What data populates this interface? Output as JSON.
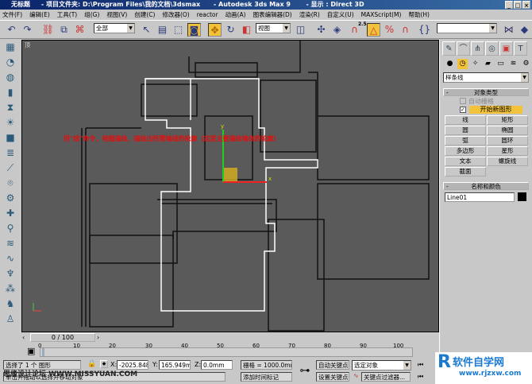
{
  "title": {
    "text": "无标题     - 项目文件夹: D:\\Program Files\\我的文档\\3dsmax      - Autodesk 3ds Max 9       - 显示 : Direct 3D",
    "min": "_",
    "max": "□",
    "close": "×"
  },
  "menu": [
    "文件(F)",
    "编辑(E)",
    "工具(T)",
    "组(G)",
    "视图(V)",
    "创建(C)",
    "修改器(O)",
    "reactor",
    "动画(A)",
    "图表编辑器(D)",
    "渲染(R)",
    "自定义(U)",
    "MAXScript(M)",
    "帮助(H)"
  ],
  "toolbar": {
    "selection_filter": "全部",
    "ref_coord": "视图",
    "named_sel": "",
    "snap_value": "2.5"
  },
  "viewport": {
    "label": "顶",
    "instruction": "用\"线\"命令，将图描绘，描绘出所需墙线的轮廓（这里主要描绘墙体的轮廓）"
  },
  "panel": {
    "category": "样条线",
    "object_type": {
      "title": "对象类型",
      "auto_grid": "自动栅格",
      "start_new_shape": "开始新图形",
      "buttons": [
        "线",
        "矩形",
        "圆",
        "椭圆",
        "弧",
        "圆环",
        "多边形",
        "星形",
        "文本",
        "螺旋线",
        "截面"
      ]
    },
    "name_color": {
      "title": "名称和颜色",
      "name": "Line01",
      "color": "#000000"
    }
  },
  "timeslider": {
    "value": "0 / 100",
    "ticks": [
      "0",
      "10",
      "20",
      "30",
      "40",
      "50",
      "60",
      "70",
      "80",
      "90",
      "100"
    ]
  },
  "status": {
    "selected": "选择了 1 个 图形",
    "prompt": "单击并拖动以选择并移动对象",
    "x": "-2025.848",
    "y": "165.949mm",
    "z": "0.0mm",
    "grid": "栅格 = 1000.0mm",
    "add_time_tag": "添加时间标记",
    "auto_key": "自动关键点",
    "set_key": "设置关键点",
    "key_mode": "选定对象",
    "key_filters": "关键点过滤器..."
  },
  "watermarks": {
    "left": "思缘设计论坛 WWW.MISSYUAN.COM",
    "right": "软件自学网",
    "right_url": "www.rjzxw.com"
  }
}
